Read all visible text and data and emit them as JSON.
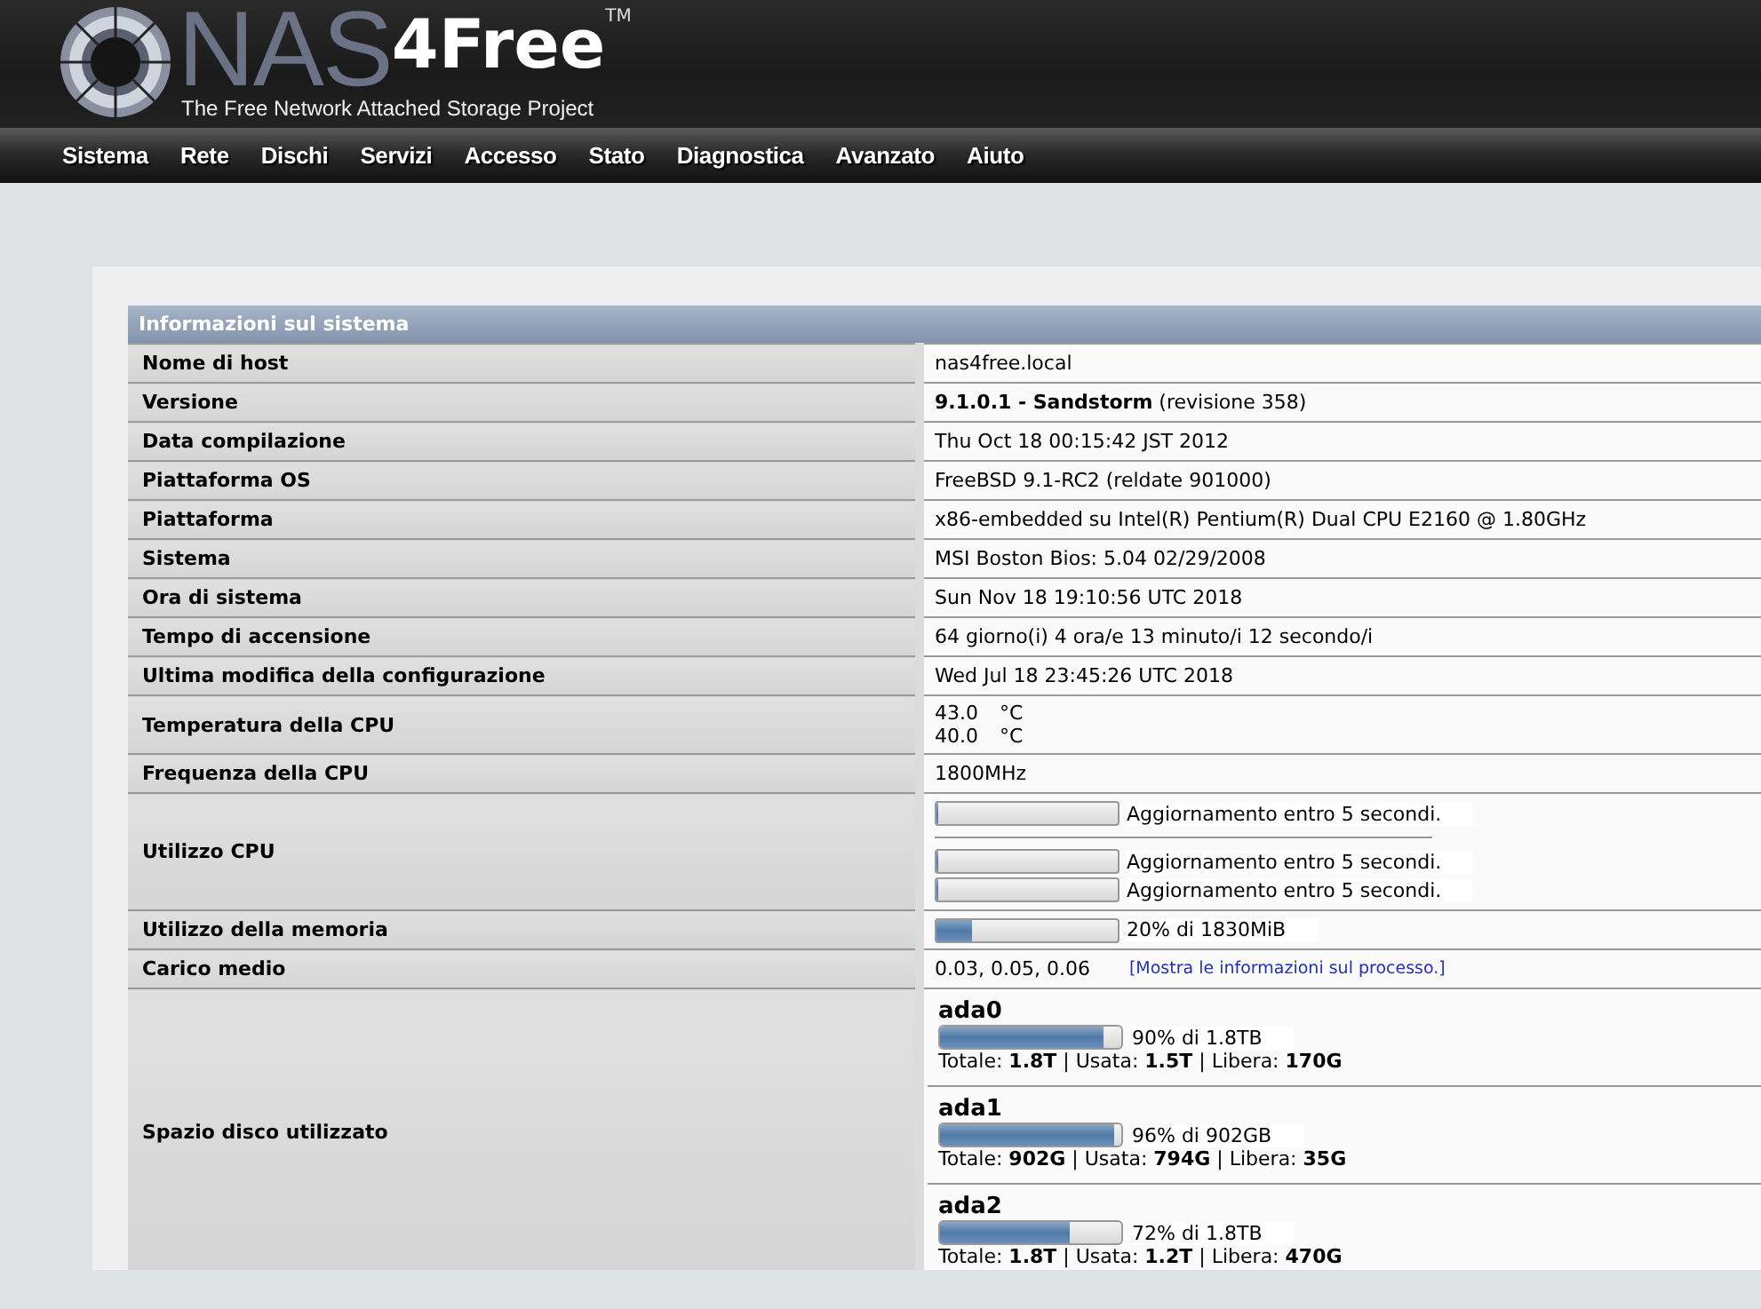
{
  "header": {
    "logo_main": "NAS",
    "logo_accent": "4Free",
    "logo_mark": "TM",
    "tagline": "The Free Network Attached Storage Project"
  },
  "nav": [
    {
      "label": "Sistema"
    },
    {
      "label": "Rete"
    },
    {
      "label": "Dischi"
    },
    {
      "label": "Servizi"
    },
    {
      "label": "Accesso"
    },
    {
      "label": "Stato"
    },
    {
      "label": "Diagnostica"
    },
    {
      "label": "Avanzato"
    },
    {
      "label": "Aiuto"
    }
  ],
  "panel": {
    "title": "Informazioni sul sistema",
    "rows": [
      {
        "kind": "text",
        "label": "Nome di host",
        "value": "nas4free.local"
      },
      {
        "kind": "text",
        "label": "Versione",
        "value": "**9.1.0.1 - Sandstorm** (revisione 358)"
      },
      {
        "kind": "text",
        "label": "Data compilazione",
        "value": "Thu Oct 18 00:15:42 JST 2012"
      },
      {
        "kind": "text",
        "label": "Piattaforma OS",
        "value": "FreeBSD 9.1-RC2 (reldate 901000)"
      },
      {
        "kind": "text",
        "label": "Piattaforma",
        "value": "x86-embedded su Intel(R) Pentium(R) Dual CPU E2160 @ 1.80GHz"
      },
      {
        "kind": "text",
        "label": "Sistema",
        "value": "MSI Boston Bios: 5.04 02/29/2008"
      },
      {
        "kind": "text",
        "label": "Ora di sistema",
        "value": "Sun Nov 18 19:10:56 UTC 2018"
      },
      {
        "kind": "text",
        "label": "Tempo di accensione",
        "value": "64 giorno(i) 4 ora/e 13 minuto/i 12 secondo/i"
      },
      {
        "kind": "text",
        "label": "Ultima modifica della configurazione",
        "value": "Wed Jul 18 23:45:26 UTC 2018"
      },
      {
        "kind": "temps",
        "label": "Temperatura della CPU",
        "temps": [
          {
            "value": "43.0",
            "unit": "°C"
          },
          {
            "value": "40.0",
            "unit": "°C"
          }
        ]
      },
      {
        "kind": "text",
        "label": "Frequenza della CPU",
        "value": "1800MHz"
      },
      {
        "kind": "cpu",
        "label": "Utilizzo CPU",
        "total": {
          "level": 0,
          "text": "Aggiornamento entro 5 secondi."
        },
        "cores": [
          {
            "level": 0,
            "text": "Aggiornamento entro 5 secondi."
          },
          {
            "level": 0,
            "text": "Aggiornamento entro 5 secondi."
          }
        ]
      },
      {
        "kind": "memory",
        "label": "Utilizzo della memoria",
        "level": 0.2,
        "text": "20% di 1830MiB"
      },
      {
        "kind": "load",
        "label": "Carico medio",
        "value": "0.03, 0.05, 0.06",
        "link": "[Mostra le informazioni sul processo.]"
      },
      {
        "kind": "disks",
        "label": "Spazio disco utilizzato",
        "disks": [
          {
            "name": "ada0",
            "level": 0.9,
            "usage": "90% di 1.8TB",
            "summary": "Totale: **1.8T** | Usata: **1.5T** | Libera: **170G**"
          },
          {
            "name": "ada1",
            "level": 0.96,
            "usage": "96% di 902GB",
            "summary": "Totale: **902G** | Usata: **794G** | Libera: **35G**"
          },
          {
            "name": "ada2",
            "level": 0.72,
            "usage": "72% di 1.8TB",
            "summary": "Totale: **1.8T** | Usata: **1.2T** | Libera: **470G**"
          }
        ]
      }
    ]
  }
}
